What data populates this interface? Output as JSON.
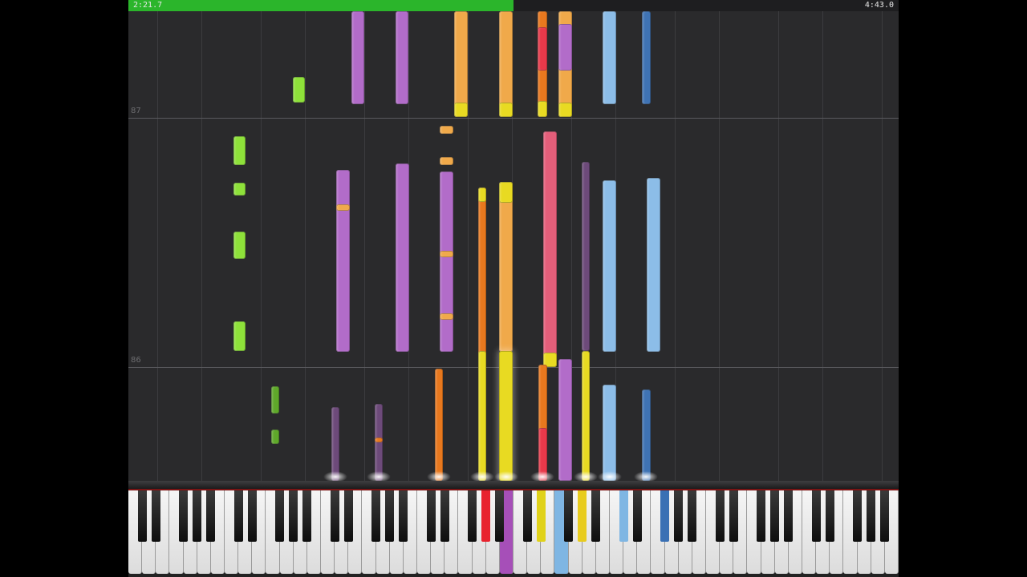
{
  "player": {
    "elapsed": "2:21.7",
    "total": "4:43.0",
    "progress": 0.5,
    "accent": "#2bb52b"
  },
  "measures": [
    {
      "label": "87"
    },
    {
      "label": "86"
    }
  ],
  "keyboard": {
    "white_key_count": 56,
    "pressed": [
      {
        "color": "#e8232e"
      },
      {
        "color": "#a64fb8"
      },
      {
        "color": "#e0d21a"
      },
      {
        "color": "#e8cc1e"
      },
      {
        "color": "#7fb6e3"
      },
      {
        "color": "#3a70b4"
      }
    ]
  },
  "note_colors": {
    "green": "#8ee13a",
    "dark_green": "#5fa82a",
    "purple": "#b26cc9",
    "dark_purple": "#6d4a7a",
    "orange": "#f0a94a",
    "dark_orange": "#e8781e",
    "yellow": "#e8da22",
    "red": "#e8394a",
    "pink": "#e45e7a",
    "light_blue": "#8cbde8",
    "blue": "#3f73b4"
  },
  "icons": {
    "note": "note-bar",
    "key": "piano-key"
  }
}
